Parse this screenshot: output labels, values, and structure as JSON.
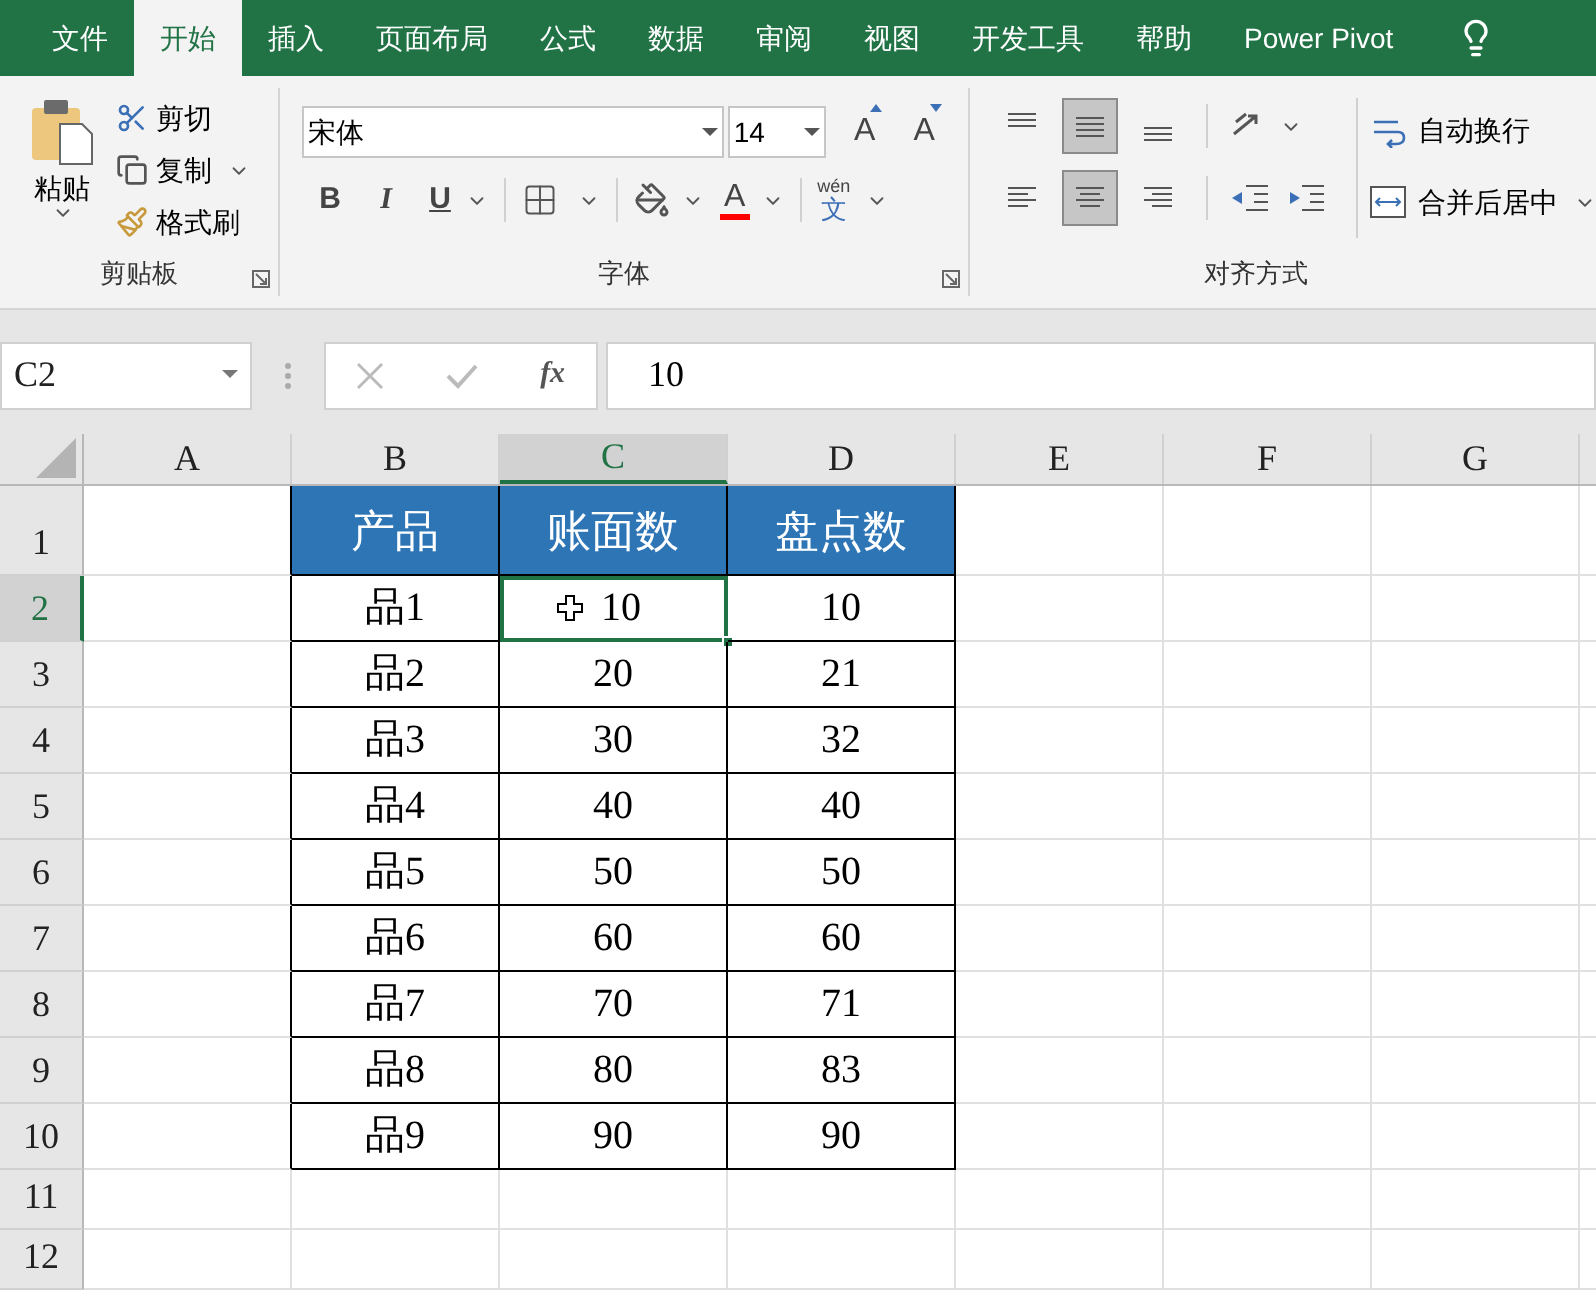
{
  "tabs": [
    {
      "label": "文件",
      "selected": false
    },
    {
      "label": "开始",
      "selected": true
    },
    {
      "label": "插入",
      "selected": false
    },
    {
      "label": "页面布局",
      "selected": false
    },
    {
      "label": "公式",
      "selected": false
    },
    {
      "label": "数据",
      "selected": false
    },
    {
      "label": "审阅",
      "selected": false
    },
    {
      "label": "视图",
      "selected": false
    },
    {
      "label": "开发工具",
      "selected": false
    },
    {
      "label": "帮助",
      "selected": false
    },
    {
      "label": "Power Pivot",
      "selected": false
    }
  ],
  "ribbon": {
    "clipboard": {
      "paste": "粘贴",
      "cut": "剪切",
      "copy": "复制",
      "format_painter": "格式刷",
      "label": "剪贴板"
    },
    "font": {
      "name": "宋体",
      "size": "14",
      "grow": "A",
      "shrink": "A",
      "bold": "B",
      "italic": "I",
      "underline": "U",
      "font_color": "A",
      "phonetic": "wén",
      "phonetic_char": "文",
      "label": "字体"
    },
    "alignment": {
      "vertical": [
        {
          "kind": "top",
          "selected": false
        },
        {
          "kind": "middle",
          "selected": true
        },
        {
          "kind": "bottom",
          "selected": false
        }
      ],
      "horizontal": [
        {
          "kind": "left",
          "selected": false
        },
        {
          "kind": "center",
          "selected": true
        },
        {
          "kind": "right",
          "selected": false
        }
      ],
      "wrap": "自动换行",
      "merge": "合并后居中",
      "label": "对齐方式"
    }
  },
  "formula_bar": {
    "name_box": "C2",
    "fx": "fx",
    "value": "10"
  },
  "sheet": {
    "columns": [
      {
        "label": "A",
        "selected": false
      },
      {
        "label": "B",
        "selected": false
      },
      {
        "label": "C",
        "selected": true
      },
      {
        "label": "D",
        "selected": false
      },
      {
        "label": "E",
        "selected": false
      },
      {
        "label": "F",
        "selected": false
      },
      {
        "label": "G",
        "selected": false
      }
    ],
    "rows": [
      {
        "label": "1",
        "selected": false
      },
      {
        "label": "2",
        "selected": true
      },
      {
        "label": "3",
        "selected": false
      },
      {
        "label": "4",
        "selected": false
      },
      {
        "label": "5",
        "selected": false
      },
      {
        "label": "6",
        "selected": false
      },
      {
        "label": "7",
        "selected": false
      },
      {
        "label": "8",
        "selected": false
      },
      {
        "label": "9",
        "selected": false
      },
      {
        "label": "10",
        "selected": false
      },
      {
        "label": "11",
        "selected": false
      },
      {
        "label": "12",
        "selected": false
      }
    ],
    "table": {
      "header": [
        "产品",
        "账面数",
        "盘点数"
      ],
      "rows": [
        {
          "cells": [
            {
              "text": "品1",
              "selected": false
            },
            {
              "text": "10",
              "selected": true
            },
            {
              "text": "10",
              "selected": false
            }
          ]
        },
        {
          "cells": [
            {
              "text": "品2",
              "selected": false
            },
            {
              "text": "20",
              "selected": false
            },
            {
              "text": "21",
              "selected": false
            }
          ]
        },
        {
          "cells": [
            {
              "text": "品3",
              "selected": false
            },
            {
              "text": "30",
              "selected": false
            },
            {
              "text": "32",
              "selected": false
            }
          ]
        },
        {
          "cells": [
            {
              "text": "品4",
              "selected": false
            },
            {
              "text": "40",
              "selected": false
            },
            {
              "text": "40",
              "selected": false
            }
          ]
        },
        {
          "cells": [
            {
              "text": "品5",
              "selected": false
            },
            {
              "text": "50",
              "selected": false
            },
            {
              "text": "50",
              "selected": false
            }
          ]
        },
        {
          "cells": [
            {
              "text": "品6",
              "selected": false
            },
            {
              "text": "60",
              "selected": false
            },
            {
              "text": "60",
              "selected": false
            }
          ]
        },
        {
          "cells": [
            {
              "text": "品7",
              "selected": false
            },
            {
              "text": "70",
              "selected": false
            },
            {
              "text": "71",
              "selected": false
            }
          ]
        },
        {
          "cells": [
            {
              "text": "品8",
              "selected": false
            },
            {
              "text": "80",
              "selected": false
            },
            {
              "text": "83",
              "selected": false
            }
          ]
        },
        {
          "cells": [
            {
              "text": "品9",
              "selected": false
            },
            {
              "text": "90",
              "selected": false
            },
            {
              "text": "90",
              "selected": false
            }
          ]
        }
      ]
    }
  }
}
